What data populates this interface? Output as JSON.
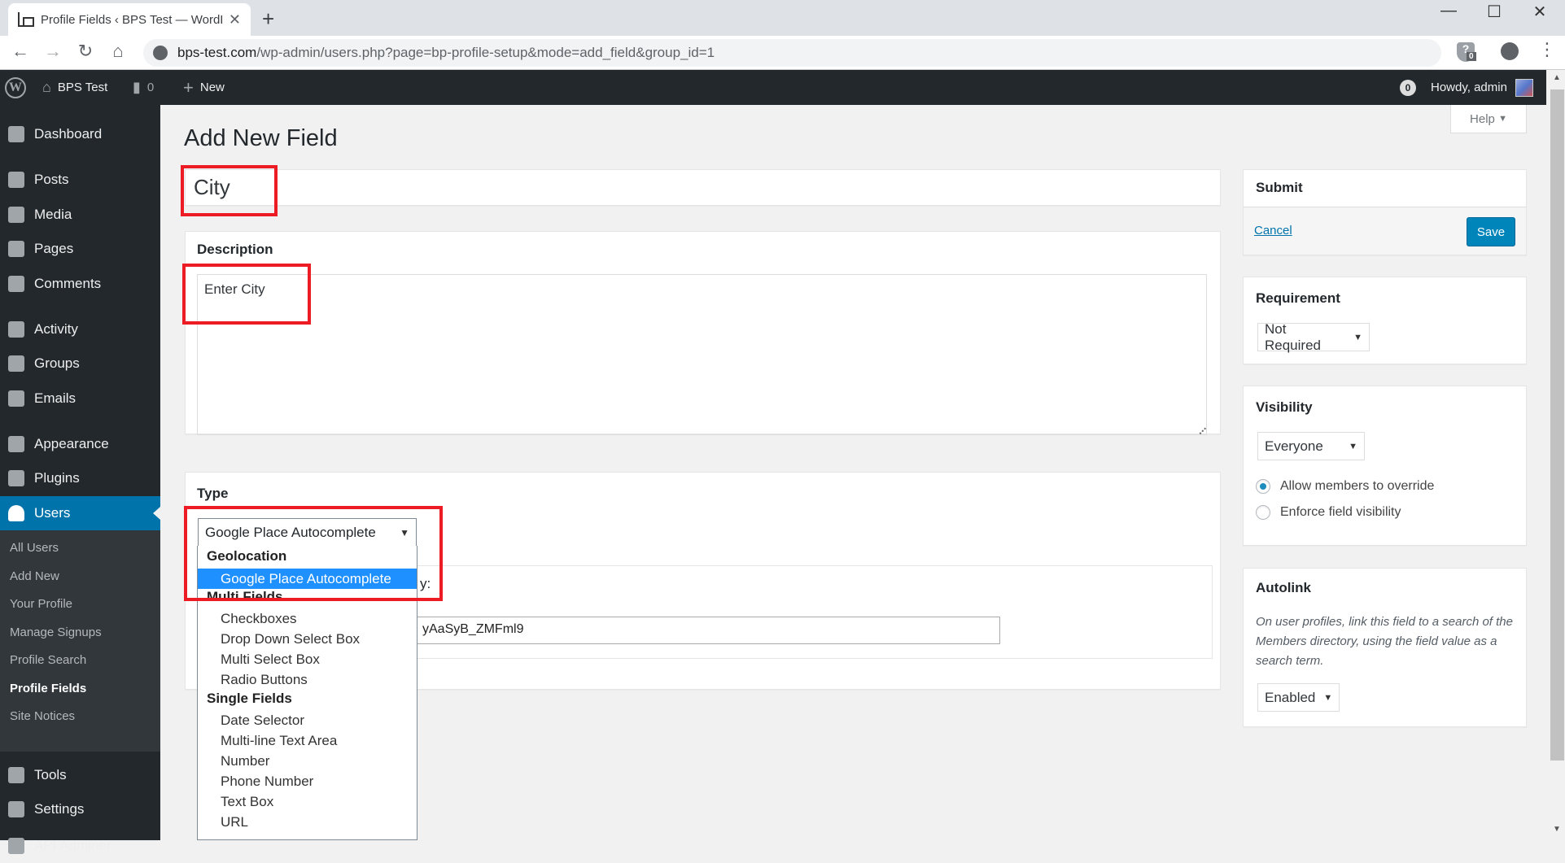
{
  "browser": {
    "tab_title": "Profile Fields ‹ BPS Test — WordPress",
    "tab_title_visible": "Profile Fields ‹ BPS Test — WordP",
    "url_host": "bps-test.com",
    "url_path": "/wp-admin/users.php?page=bp-profile-setup&mode=add_field&group_id=1",
    "extension_badge": "0",
    "icons": {
      "back": "←",
      "forward": "→",
      "reload": "↻",
      "home": "⌂",
      "new_tab": "+",
      "close": "✕",
      "minimize": "—",
      "maximize": "☐",
      "window_close": "✕",
      "menu": "⋮"
    }
  },
  "adminbar": {
    "site_name": "BPS Test",
    "comments_count": "0",
    "new_label": "New",
    "notifications_count": "0",
    "howdy": "Howdy, admin"
  },
  "sidebar": {
    "items": [
      {
        "label": "Dashboard",
        "icon": "dashboard-icon"
      },
      {
        "label": "Posts",
        "icon": "pin-icon"
      },
      {
        "label": "Media",
        "icon": "media-icon"
      },
      {
        "label": "Pages",
        "icon": "pages-icon"
      },
      {
        "label": "Comments",
        "icon": "comment-icon"
      },
      {
        "label": "Activity",
        "icon": "activity-icon"
      },
      {
        "label": "Groups",
        "icon": "groups-icon"
      },
      {
        "label": "Emails",
        "icon": "mail-icon"
      },
      {
        "label": "Appearance",
        "icon": "brush-icon"
      },
      {
        "label": "Plugins",
        "icon": "plug-icon"
      },
      {
        "label": "Users",
        "icon": "user-icon",
        "current": true
      },
      {
        "label": "Tools",
        "icon": "wrench-icon"
      },
      {
        "label": "Settings",
        "icon": "settings-icon"
      },
      {
        "label": "API Adminer",
        "icon": "wrench-icon"
      }
    ],
    "users_submenu": [
      {
        "label": "All Users"
      },
      {
        "label": "Add New"
      },
      {
        "label": "Your Profile"
      },
      {
        "label": "Manage Signups"
      },
      {
        "label": "Profile Search"
      },
      {
        "label": "Profile Fields",
        "current": true
      },
      {
        "label": "Site Notices"
      }
    ]
  },
  "main": {
    "page_title": "Add New Field",
    "help_label": "Help",
    "field_name_value": "City",
    "description": {
      "title": "Description",
      "value": "Enter City"
    },
    "type": {
      "title": "Type",
      "selected": "Google Place Autocomplete",
      "inner_label_visible": "y:",
      "api_key_visible": "yAaSyB_ZMFml9",
      "dropdown": [
        {
          "group": "Geolocation",
          "options": [
            "Google Place Autocomplete"
          ]
        },
        {
          "group": "Multi Fields",
          "options": [
            "Checkboxes",
            "Drop Down Select Box",
            "Multi Select Box",
            "Radio Buttons"
          ]
        },
        {
          "group": "Single Fields",
          "options": [
            "Date Selector",
            "Multi-line Text Area",
            "Number",
            "Phone Number",
            "Text Box",
            "URL"
          ]
        }
      ]
    }
  },
  "right": {
    "submit": {
      "title": "Submit",
      "cancel": "Cancel",
      "save": "Save"
    },
    "requirement": {
      "title": "Requirement",
      "selected": "Not Required"
    },
    "visibility": {
      "title": "Visibility",
      "selected": "Everyone",
      "radios": [
        {
          "label": "Allow members to override",
          "checked": true
        },
        {
          "label": "Enforce field visibility",
          "checked": false
        }
      ]
    },
    "autolink": {
      "title": "Autolink",
      "description": "On user profiles, link this field to a search of the Members directory, using the field value as a search term.",
      "selected": "Enabled"
    }
  },
  "colors": {
    "accent": "#0073aa",
    "button": "#0085ba",
    "highlight_red": "#ed1c24",
    "dropdown_selected": "#1e90ff",
    "adminbar": "#23282d",
    "submenu": "#32373c"
  }
}
